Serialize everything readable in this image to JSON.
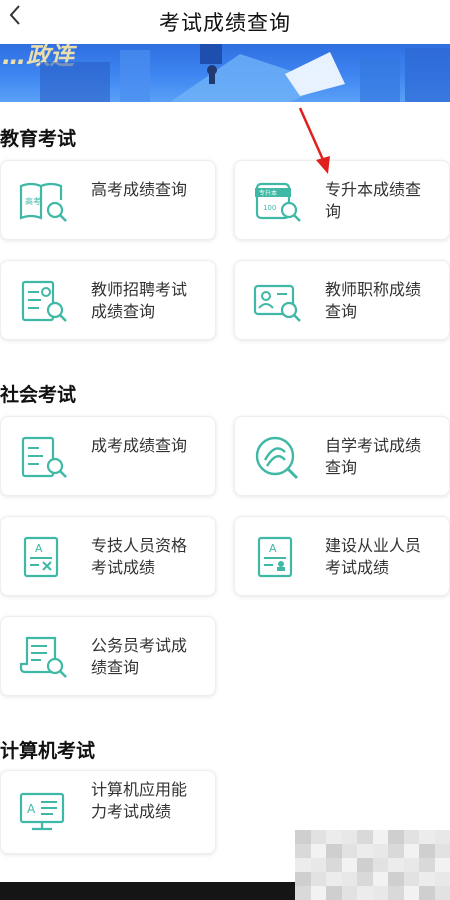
{
  "header": {
    "title": "考试成绩查询",
    "back_icon": "chevron-left-icon"
  },
  "banner": {
    "text": "…政连"
  },
  "sections": [
    {
      "title": "教育考试",
      "items": [
        {
          "label": "高考成绩查询",
          "icon": "gaokao-book-search-icon"
        },
        {
          "label": "专升本成绩查询",
          "icon": "certificate-search-icon"
        },
        {
          "label": "教师招聘考试成绩查询",
          "icon": "teacher-document-search-icon"
        },
        {
          "label": "教师职称成绩查询",
          "icon": "id-card-search-icon"
        }
      ]
    },
    {
      "title": "社会考试",
      "items": [
        {
          "label": "成考成绩查询",
          "icon": "document-search-icon"
        },
        {
          "label": "自学考试成绩查询",
          "icon": "self-study-circle-icon"
        },
        {
          "label": "专技人员资格考试成绩",
          "icon": "exam-paper-grade-icon"
        },
        {
          "label": "建设从业人员考试成绩",
          "icon": "exam-paper-person-icon"
        },
        {
          "label": "公务员考试成绩查询",
          "icon": "scroll-search-icon"
        }
      ]
    },
    {
      "title": "计算机考试",
      "items": [
        {
          "label": "计算机应用能力考试成绩",
          "icon": "computer-monitor-icon"
        }
      ]
    }
  ],
  "colors": {
    "icon_teal": "#3fb8a5",
    "banner_blue": "#3a7ee9",
    "annotation_red": "#e0201e"
  }
}
